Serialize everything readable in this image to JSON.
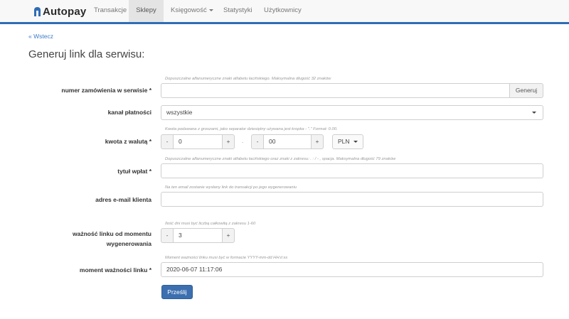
{
  "app": {
    "name": "Autopay"
  },
  "nav": {
    "items": [
      {
        "label": "Transakcje"
      },
      {
        "label": "Sklepy",
        "active": true
      },
      {
        "label": "Księgowość"
      },
      {
        "label": "Statystyki"
      },
      {
        "label": "Użytkownicy"
      }
    ]
  },
  "back_link": "« Wstecz",
  "page_title": "Generuj link dla serwisu:",
  "form": {
    "order_number": {
      "label": "numer zamówienia w serwisie",
      "required_mark": "*",
      "hint": "Dopuszczalne alfanumeryczne znaki alfabetu łacińskiego. Maksymalna długość 32 znaków",
      "value": "",
      "button": "Generuj"
    },
    "channel": {
      "label": "kanał płatności",
      "value": "wszystkie"
    },
    "amount": {
      "label": "kwota z walutą",
      "required_mark": "*",
      "hint": "Kwota podawana z groszami, jako separator dziesiętny używana jest kropka - \".\" Format: 0.00.",
      "minus": "-",
      "plus": "+",
      "whole_value": "0",
      "separator": ".",
      "fraction_value": "00",
      "currency": "PLN"
    },
    "title": {
      "label": "tytuł wpłat",
      "required_mark": "*",
      "hint": "Dopuszczalne alfanumeryczne znaki alfabetu łacińskiego oraz znaki z zakresu: . : / - , spacja. Maksymalna długość 79 znaków",
      "value": ""
    },
    "email": {
      "label": "adres e-mail klienta",
      "hint": "Na ten email zostanie wysłany link do transakcji po jego wygenerowaniu",
      "value": ""
    },
    "validity": {
      "label_line1": "ważność linku od momentu",
      "label_line2": "wygenerowania",
      "hint": "Ilość dni musi być liczbą całkowitą z zakresu 1-60",
      "minus": "-",
      "plus": "+",
      "value": "3"
    },
    "moment": {
      "label": "moment ważności linku",
      "required_mark": "*",
      "hint": "Moment ważności linku musi być w formacie YYYY-mm-dd HH:ii:ss",
      "value": "2020-06-07 11:17:06"
    },
    "submit": "Prześlij"
  }
}
